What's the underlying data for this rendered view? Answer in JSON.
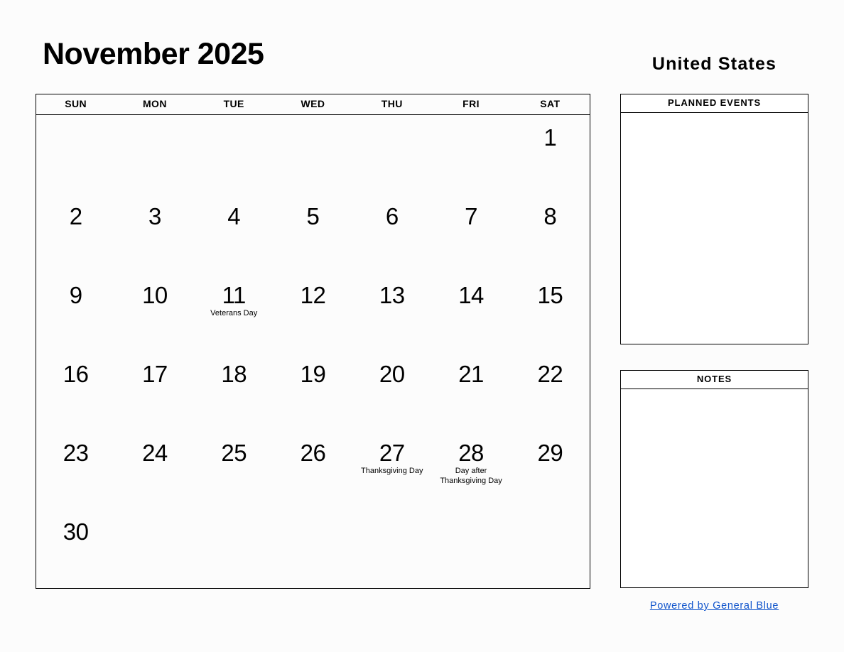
{
  "header": {
    "month_title": "November 2025",
    "country": "United States"
  },
  "calendar": {
    "weekdays": [
      "SUN",
      "MON",
      "TUE",
      "WED",
      "THU",
      "FRI",
      "SAT"
    ],
    "weeks": [
      [
        {
          "day": "",
          "event": ""
        },
        {
          "day": "",
          "event": ""
        },
        {
          "day": "",
          "event": ""
        },
        {
          "day": "",
          "event": ""
        },
        {
          "day": "",
          "event": ""
        },
        {
          "day": "",
          "event": ""
        },
        {
          "day": "1",
          "event": ""
        }
      ],
      [
        {
          "day": "2",
          "event": ""
        },
        {
          "day": "3",
          "event": ""
        },
        {
          "day": "4",
          "event": ""
        },
        {
          "day": "5",
          "event": ""
        },
        {
          "day": "6",
          "event": ""
        },
        {
          "day": "7",
          "event": ""
        },
        {
          "day": "8",
          "event": ""
        }
      ],
      [
        {
          "day": "9",
          "event": ""
        },
        {
          "day": "10",
          "event": ""
        },
        {
          "day": "11",
          "event": "Veterans Day"
        },
        {
          "day": "12",
          "event": ""
        },
        {
          "day": "13",
          "event": ""
        },
        {
          "day": "14",
          "event": ""
        },
        {
          "day": "15",
          "event": ""
        }
      ],
      [
        {
          "day": "16",
          "event": ""
        },
        {
          "day": "17",
          "event": ""
        },
        {
          "day": "18",
          "event": ""
        },
        {
          "day": "19",
          "event": ""
        },
        {
          "day": "20",
          "event": ""
        },
        {
          "day": "21",
          "event": ""
        },
        {
          "day": "22",
          "event": ""
        }
      ],
      [
        {
          "day": "23",
          "event": ""
        },
        {
          "day": "24",
          "event": ""
        },
        {
          "day": "25",
          "event": ""
        },
        {
          "day": "26",
          "event": ""
        },
        {
          "day": "27",
          "event": "Thanksgiving Day"
        },
        {
          "day": "28",
          "event": "Day after Thanksgiving Day"
        },
        {
          "day": "29",
          "event": ""
        }
      ],
      [
        {
          "day": "30",
          "event": ""
        },
        {
          "day": "",
          "event": ""
        },
        {
          "day": "",
          "event": ""
        },
        {
          "day": "",
          "event": ""
        },
        {
          "day": "",
          "event": ""
        },
        {
          "day": "",
          "event": ""
        },
        {
          "day": "",
          "event": ""
        }
      ]
    ]
  },
  "planned_events": {
    "title": "PLANNED EVENTS",
    "content": ""
  },
  "notes": {
    "title": "NOTES",
    "content": ""
  },
  "footer": {
    "link_text": "Powered by General Blue",
    "link_color": "#1155cc"
  }
}
